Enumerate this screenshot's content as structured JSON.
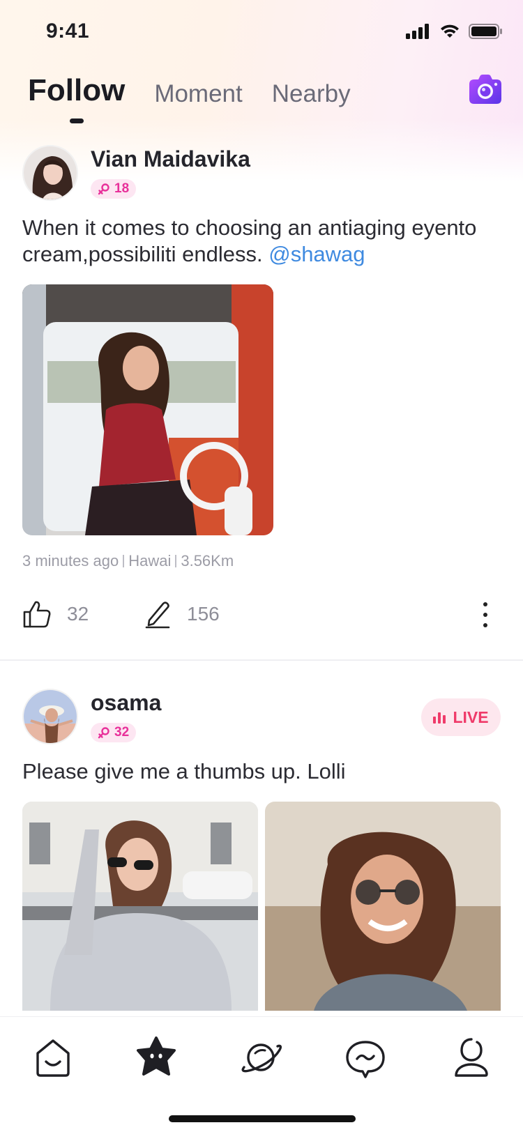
{
  "status_bar": {
    "time": "9:41"
  },
  "tabs": [
    {
      "label": "Follow",
      "active": true
    },
    {
      "label": "Moment",
      "active": false
    },
    {
      "label": "Nearby",
      "active": false
    }
  ],
  "posts": [
    {
      "user_name": "Vian Maidavika",
      "level": "18",
      "text": "When it comes to choosing an antiaging eyento cream,possibiliti endless.",
      "mention": "@shawag",
      "meta": {
        "time": "3 minutes ago",
        "place": "Hawai",
        "distance": "3.56Km"
      },
      "likes": "32",
      "comments": "156"
    },
    {
      "user_name": "osama",
      "level": "32",
      "live_label": "LIVE",
      "text": "Please give me a thumbs up. Lolli"
    }
  ],
  "colors": {
    "accent_pink": "#e8309a",
    "live_red": "#ef3b6a",
    "mention_blue": "#3f8ae0",
    "camera_purple": "#7b3cf0"
  },
  "bottom_nav": [
    {
      "name": "home-icon",
      "active": false
    },
    {
      "name": "star-face-icon",
      "active": true
    },
    {
      "name": "planet-icon",
      "active": false
    },
    {
      "name": "chat-bubble-icon",
      "active": false
    },
    {
      "name": "profile-icon",
      "active": false
    }
  ]
}
